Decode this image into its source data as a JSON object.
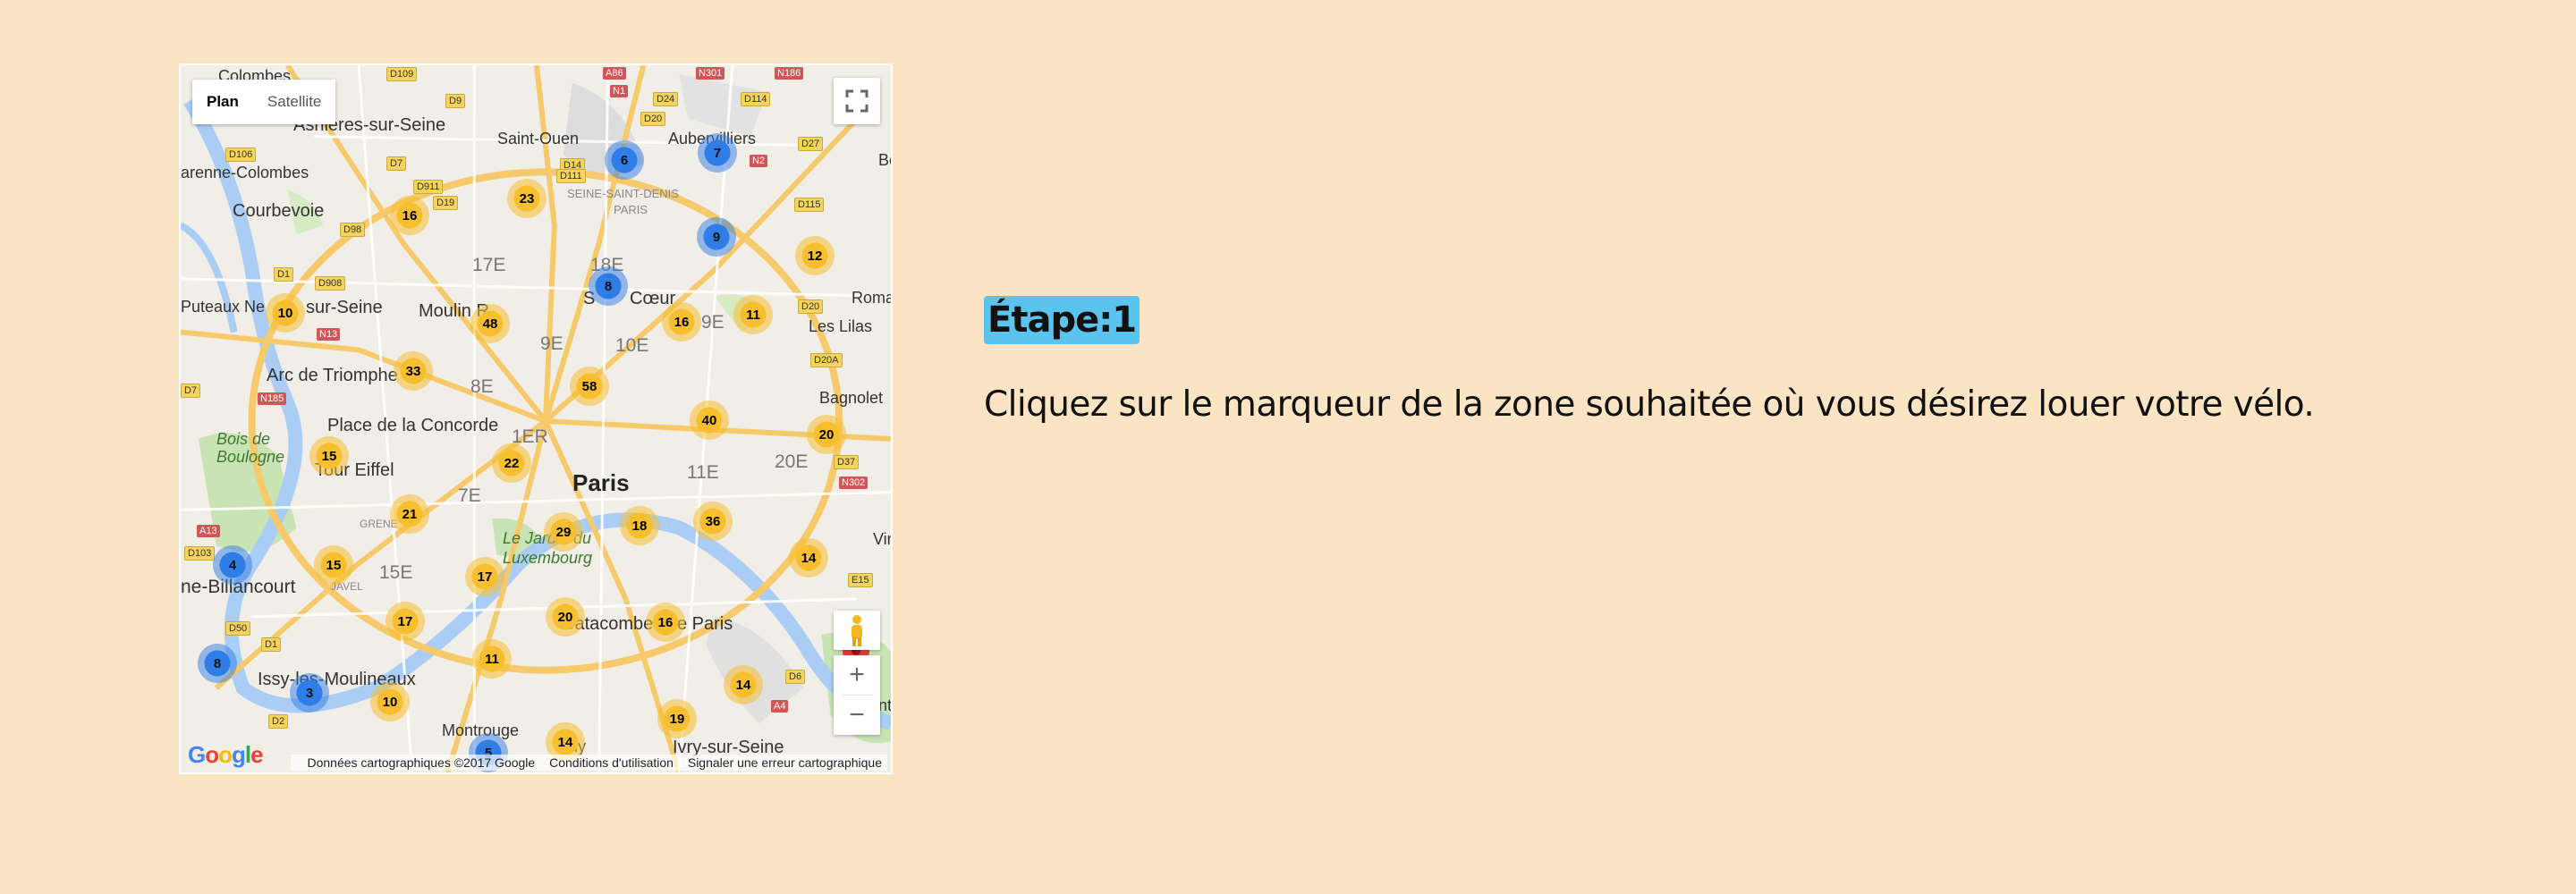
{
  "map": {
    "type_buttons": {
      "plan": "Plan",
      "satellite": "Satellite"
    },
    "zoom": {
      "in": "+",
      "out": "−"
    },
    "attribution": {
      "data": "Données cartographiques ©2017 Google",
      "terms": "Conditions d'utilisation",
      "report": "Signaler une erreur cartographique"
    },
    "logo": "Google",
    "places": {
      "colombes": "Colombes",
      "asnieres": "Asnières-sur-Seine",
      "saint_ouen": "Saint-Ouen",
      "aubervilliers": "Aubervilliers",
      "bobigny": "Bo",
      "garenne": "arenne-Colombes",
      "courbevoie": "Courbevoie",
      "seine_st_denis": "SEINE-SAINT-DENIS",
      "paris_dept": "PARIS",
      "e17": "17E",
      "e18": "18E",
      "puteaux": "Puteaux Ne",
      "sur_seine": "sur-Seine",
      "moulin": "Moulin R",
      "sacre": "S",
      "coeur": "Cœur",
      "e19": "9E",
      "romainville": "Roma",
      "lilas": "Les Lilas",
      "e9": "9E",
      "e10": "10E",
      "arc": "Arc de Triomphe",
      "e8": "8E",
      "bagnolet": "Bagnolet",
      "bois": "Bois de\nBoulogne",
      "concorde": "Place de la Concorde",
      "e1": "1ER",
      "e20": "20E",
      "tour": "Tour Eiffel",
      "paris": "Paris",
      "e11": "11E",
      "e7": "7E",
      "grenelle": "GRENE",
      "jardin": "Le Jardin du\nLuxembourg",
      "vin": "Vin",
      "billancourt": "ne-Billancourt",
      "e15": "15E",
      "javel": "JAVEL",
      "catacombes": "Catacombes de Paris",
      "issy": "Issy-les-Moulineaux",
      "montrouge": "Montrouge",
      "gentilly": "illy",
      "ivry": "Ivry-sur-Seine",
      "saint": "Saint-"
    },
    "road_labels": [
      "D109",
      "D9",
      "A86",
      "N301",
      "N186",
      "N1",
      "D24",
      "D114",
      "D20",
      "N2",
      "D27",
      "D7",
      "D106",
      "D911",
      "D19",
      "D14",
      "D111",
      "D115",
      "D98",
      "D1",
      "D908",
      "N13",
      "D20",
      "D20A",
      "N185",
      "D7",
      "N302",
      "A13",
      "D37",
      "D103",
      "E15",
      "D50",
      "D1",
      "D6",
      "D2",
      "A4"
    ],
    "clusters": [
      {
        "n": "6",
        "c": "b"
      },
      {
        "n": "7",
        "c": "b"
      },
      {
        "n": "23",
        "c": "y"
      },
      {
        "n": "16",
        "c": "y"
      },
      {
        "n": "9",
        "c": "b"
      },
      {
        "n": "12",
        "c": "y"
      },
      {
        "n": "8",
        "c": "b"
      },
      {
        "n": "10",
        "c": "y"
      },
      {
        "n": "48",
        "c": "y"
      },
      {
        "n": "16",
        "c": "y"
      },
      {
        "n": "11",
        "c": "y"
      },
      {
        "n": "33",
        "c": "y"
      },
      {
        "n": "58",
        "c": "y"
      },
      {
        "n": "40",
        "c": "y"
      },
      {
        "n": "20",
        "c": "y"
      },
      {
        "n": "15",
        "c": "y"
      },
      {
        "n": "22",
        "c": "y"
      },
      {
        "n": "21",
        "c": "y"
      },
      {
        "n": "29",
        "c": "y"
      },
      {
        "n": "18",
        "c": "y"
      },
      {
        "n": "36",
        "c": "y"
      },
      {
        "n": "4",
        "c": "b"
      },
      {
        "n": "15",
        "c": "y"
      },
      {
        "n": "17",
        "c": "y"
      },
      {
        "n": "14",
        "c": "y"
      },
      {
        "n": "17",
        "c": "y"
      },
      {
        "n": "20",
        "c": "y"
      },
      {
        "n": "16",
        "c": "y"
      },
      {
        "n": "8",
        "c": "b"
      },
      {
        "n": "11",
        "c": "y"
      },
      {
        "n": "3",
        "c": "b"
      },
      {
        "n": "10",
        "c": "y"
      },
      {
        "n": "14",
        "c": "y"
      },
      {
        "n": "19",
        "c": "y"
      },
      {
        "n": "14",
        "c": "y"
      },
      {
        "n": "5",
        "c": "b"
      }
    ],
    "colors": {
      "yellow_cluster": "#f7be2e",
      "blue_cluster": "#2f7de6",
      "water": "#a9cdf5",
      "park": "#c9e4b4",
      "highway": "#f6c96a"
    }
  },
  "step": {
    "title": "Étape:1",
    "instruction": "Cliquez sur le marqueur de la zone souhaitée où vous désirez louer votre vélo."
  }
}
